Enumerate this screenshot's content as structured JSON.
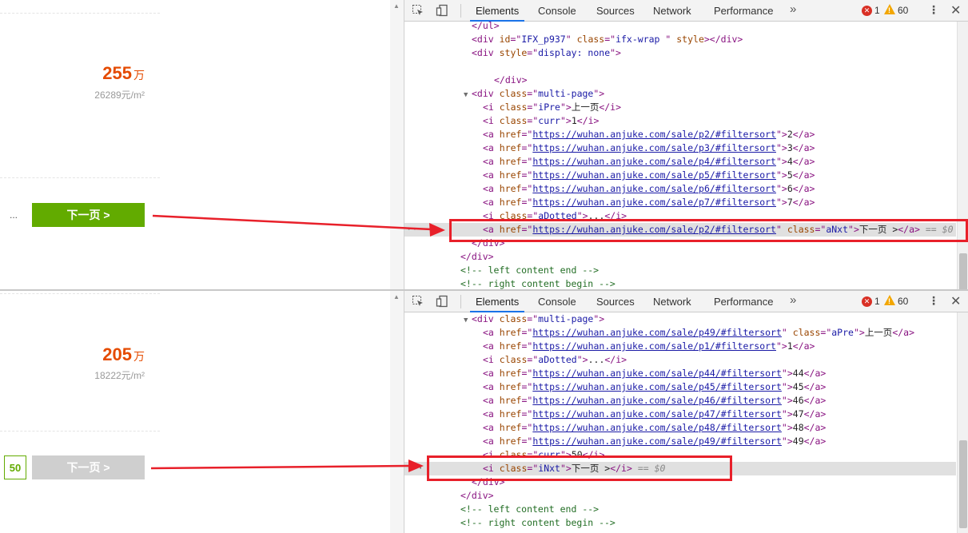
{
  "top": {
    "listing": {
      "price": "255",
      "price_unit": "万",
      "unit_price": "26289元/m²"
    },
    "ellipsis": "...",
    "next_button": "下一页 >",
    "devtools": {
      "tabs": [
        "Elements",
        "Console",
        "Sources",
        "Network",
        "Performance"
      ],
      "more": "»",
      "errors": "1",
      "warnings": "60",
      "lines": [
        {
          "indent": 12,
          "t": [
            [
              "tag",
              "</ul>"
            ]
          ]
        },
        {
          "indent": 12,
          "t": [
            [
              "tag",
              "<div "
            ],
            [
              "an",
              "id"
            ],
            [
              "tag",
              "=\""
            ],
            [
              "av",
              "IFX_p937"
            ],
            [
              "tag",
              "\" "
            ],
            [
              "an",
              "class"
            ],
            [
              "tag",
              "=\""
            ],
            [
              "av",
              "ifx-wrap "
            ],
            [
              "tag",
              "\" "
            ],
            [
              "an",
              "style"
            ],
            [
              "tag",
              "></div>"
            ]
          ]
        },
        {
          "indent": 12,
          "t": [
            [
              "tag",
              "<div "
            ],
            [
              "an",
              "style"
            ],
            [
              "tag",
              "=\""
            ],
            [
              "av",
              "display: none"
            ],
            [
              "tag",
              "\">"
            ]
          ]
        },
        {
          "indent": 12,
          "t": []
        },
        {
          "indent": 16,
          "t": [
            [
              "tag",
              "</div>"
            ]
          ]
        },
        {
          "indent": 12,
          "tw": "▼",
          "t": [
            [
              "tag",
              "<div "
            ],
            [
              "an",
              "class"
            ],
            [
              "tag",
              "=\""
            ],
            [
              "av",
              "multi-page"
            ],
            [
              "tag",
              "\">"
            ]
          ]
        },
        {
          "indent": 14,
          "t": [
            [
              "tag",
              "<i "
            ],
            [
              "an",
              "class"
            ],
            [
              "tag",
              "=\""
            ],
            [
              "av",
              "iPre"
            ],
            [
              "tag",
              "\">"
            ],
            [
              "tx",
              "上一页"
            ],
            [
              "tag",
              "</i>"
            ]
          ]
        },
        {
          "indent": 14,
          "t": [
            [
              "tag",
              "<i "
            ],
            [
              "an",
              "class"
            ],
            [
              "tag",
              "=\""
            ],
            [
              "av",
              "curr"
            ],
            [
              "tag",
              "\">"
            ],
            [
              "tx",
              "1"
            ],
            [
              "tag",
              "</i>"
            ]
          ]
        },
        {
          "indent": 14,
          "t": [
            [
              "tag",
              "<a "
            ],
            [
              "an",
              "href"
            ],
            [
              "tag",
              "=\""
            ],
            [
              "lk",
              "https://wuhan.anjuke.com/sale/p2/#filtersort"
            ],
            [
              "tag",
              "\">"
            ],
            [
              "tx",
              "2"
            ],
            [
              "tag",
              "</a>"
            ]
          ]
        },
        {
          "indent": 14,
          "t": [
            [
              "tag",
              "<a "
            ],
            [
              "an",
              "href"
            ],
            [
              "tag",
              "=\""
            ],
            [
              "lk",
              "https://wuhan.anjuke.com/sale/p3/#filtersort"
            ],
            [
              "tag",
              "\">"
            ],
            [
              "tx",
              "3"
            ],
            [
              "tag",
              "</a>"
            ]
          ]
        },
        {
          "indent": 14,
          "t": [
            [
              "tag",
              "<a "
            ],
            [
              "an",
              "href"
            ],
            [
              "tag",
              "=\""
            ],
            [
              "lk",
              "https://wuhan.anjuke.com/sale/p4/#filtersort"
            ],
            [
              "tag",
              "\">"
            ],
            [
              "tx",
              "4"
            ],
            [
              "tag",
              "</a>"
            ]
          ]
        },
        {
          "indent": 14,
          "t": [
            [
              "tag",
              "<a "
            ],
            [
              "an",
              "href"
            ],
            [
              "tag",
              "=\""
            ],
            [
              "lk",
              "https://wuhan.anjuke.com/sale/p5/#filtersort"
            ],
            [
              "tag",
              "\">"
            ],
            [
              "tx",
              "5"
            ],
            [
              "tag",
              "</a>"
            ]
          ]
        },
        {
          "indent": 14,
          "t": [
            [
              "tag",
              "<a "
            ],
            [
              "an",
              "href"
            ],
            [
              "tag",
              "=\""
            ],
            [
              "lk",
              "https://wuhan.anjuke.com/sale/p6/#filtersort"
            ],
            [
              "tag",
              "\">"
            ],
            [
              "tx",
              "6"
            ],
            [
              "tag",
              "</a>"
            ]
          ]
        },
        {
          "indent": 14,
          "t": [
            [
              "tag",
              "<a "
            ],
            [
              "an",
              "href"
            ],
            [
              "tag",
              "=\""
            ],
            [
              "lk",
              "https://wuhan.anjuke.com/sale/p7/#filtersort"
            ],
            [
              "tag",
              "\">"
            ],
            [
              "tx",
              "7"
            ],
            [
              "tag",
              "</a>"
            ]
          ]
        },
        {
          "indent": 14,
          "t": [
            [
              "tag",
              "<i "
            ],
            [
              "an",
              "class"
            ],
            [
              "tag",
              "=\""
            ],
            [
              "av",
              "aDotted"
            ],
            [
              "tag",
              "\">"
            ],
            [
              "tx",
              "..."
            ],
            [
              "tag",
              "</i>"
            ]
          ]
        },
        {
          "indent": 14,
          "sel": true,
          "t": [
            [
              "tag",
              "<a "
            ],
            [
              "an",
              "href"
            ],
            [
              "tag",
              "=\""
            ],
            [
              "lk",
              "https://wuhan.anjuke.com/sale/p2/#filtersort"
            ],
            [
              "tag",
              "\" "
            ],
            [
              "an",
              "class"
            ],
            [
              "tag",
              "=\""
            ],
            [
              "av",
              "aNxt"
            ],
            [
              "tag",
              "\">"
            ],
            [
              "tx",
              "下一页 >"
            ],
            [
              "tag",
              "</a>"
            ],
            [
              "sv",
              " == $0"
            ]
          ]
        },
        {
          "indent": 12,
          "t": [
            [
              "tag",
              "</div>"
            ]
          ]
        },
        {
          "indent": 10,
          "t": [
            [
              "tag",
              "</div>"
            ]
          ]
        },
        {
          "indent": 10,
          "t": [
            [
              "cm",
              "<!-- left content end -->"
            ]
          ]
        },
        {
          "indent": 10,
          "t": [
            [
              "cm",
              "<!-- right content begin -->"
            ]
          ]
        }
      ]
    }
  },
  "bottom": {
    "listing": {
      "price": "205",
      "price_unit": "万",
      "unit_price": "18222元/m²"
    },
    "current_page": "50",
    "next_button": "下一页 >",
    "devtools": {
      "tabs": [
        "Elements",
        "Console",
        "Sources",
        "Network",
        "Performance"
      ],
      "more": "»",
      "errors": "1",
      "warnings": "60",
      "lines": [
        {
          "indent": 12,
          "tw": "▼",
          "t": [
            [
              "tag",
              "<div "
            ],
            [
              "an",
              "class"
            ],
            [
              "tag",
              "=\""
            ],
            [
              "av",
              "multi-page"
            ],
            [
              "tag",
              "\">"
            ]
          ]
        },
        {
          "indent": 14,
          "t": [
            [
              "tag",
              "<a "
            ],
            [
              "an",
              "href"
            ],
            [
              "tag",
              "=\""
            ],
            [
              "lk",
              "https://wuhan.anjuke.com/sale/p49/#filtersort"
            ],
            [
              "tag",
              "\" "
            ],
            [
              "an",
              "class"
            ],
            [
              "tag",
              "=\""
            ],
            [
              "av",
              "aPre"
            ],
            [
              "tag",
              "\">"
            ],
            [
              "tx",
              "上一页"
            ],
            [
              "tag",
              "</a>"
            ]
          ]
        },
        {
          "indent": 14,
          "t": [
            [
              "tag",
              "<a "
            ],
            [
              "an",
              "href"
            ],
            [
              "tag",
              "=\""
            ],
            [
              "lk",
              "https://wuhan.anjuke.com/sale/p1/#filtersort"
            ],
            [
              "tag",
              "\">"
            ],
            [
              "tx",
              "1"
            ],
            [
              "tag",
              "</a>"
            ]
          ]
        },
        {
          "indent": 14,
          "t": [
            [
              "tag",
              "<i "
            ],
            [
              "an",
              "class"
            ],
            [
              "tag",
              "=\""
            ],
            [
              "av",
              "aDotted"
            ],
            [
              "tag",
              "\">"
            ],
            [
              "tx",
              "..."
            ],
            [
              "tag",
              "</i>"
            ]
          ]
        },
        {
          "indent": 14,
          "t": [
            [
              "tag",
              "<a "
            ],
            [
              "an",
              "href"
            ],
            [
              "tag",
              "=\""
            ],
            [
              "lk",
              "https://wuhan.anjuke.com/sale/p44/#filtersort"
            ],
            [
              "tag",
              "\">"
            ],
            [
              "tx",
              "44"
            ],
            [
              "tag",
              "</a>"
            ]
          ]
        },
        {
          "indent": 14,
          "t": [
            [
              "tag",
              "<a "
            ],
            [
              "an",
              "href"
            ],
            [
              "tag",
              "=\""
            ],
            [
              "lk",
              "https://wuhan.anjuke.com/sale/p45/#filtersort"
            ],
            [
              "tag",
              "\">"
            ],
            [
              "tx",
              "45"
            ],
            [
              "tag",
              "</a>"
            ]
          ]
        },
        {
          "indent": 14,
          "t": [
            [
              "tag",
              "<a "
            ],
            [
              "an",
              "href"
            ],
            [
              "tag",
              "=\""
            ],
            [
              "lk",
              "https://wuhan.anjuke.com/sale/p46/#filtersort"
            ],
            [
              "tag",
              "\">"
            ],
            [
              "tx",
              "46"
            ],
            [
              "tag",
              "</a>"
            ]
          ]
        },
        {
          "indent": 14,
          "t": [
            [
              "tag",
              "<a "
            ],
            [
              "an",
              "href"
            ],
            [
              "tag",
              "=\""
            ],
            [
              "lk",
              "https://wuhan.anjuke.com/sale/p47/#filtersort"
            ],
            [
              "tag",
              "\">"
            ],
            [
              "tx",
              "47"
            ],
            [
              "tag",
              "</a>"
            ]
          ]
        },
        {
          "indent": 14,
          "t": [
            [
              "tag",
              "<a "
            ],
            [
              "an",
              "href"
            ],
            [
              "tag",
              "=\""
            ],
            [
              "lk",
              "https://wuhan.anjuke.com/sale/p48/#filtersort"
            ],
            [
              "tag",
              "\">"
            ],
            [
              "tx",
              "48"
            ],
            [
              "tag",
              "</a>"
            ]
          ]
        },
        {
          "indent": 14,
          "t": [
            [
              "tag",
              "<a "
            ],
            [
              "an",
              "href"
            ],
            [
              "tag",
              "=\""
            ],
            [
              "lk",
              "https://wuhan.anjuke.com/sale/p49/#filtersort"
            ],
            [
              "tag",
              "\">"
            ],
            [
              "tx",
              "49"
            ],
            [
              "tag",
              "</a>"
            ]
          ]
        },
        {
          "indent": 14,
          "t": [
            [
              "tag",
              "<i "
            ],
            [
              "an",
              "class"
            ],
            [
              "tag",
              "=\""
            ],
            [
              "av",
              "curr"
            ],
            [
              "tag",
              "\">"
            ],
            [
              "tx",
              "50"
            ],
            [
              "tag",
              "</i>"
            ]
          ]
        },
        {
          "indent": 14,
          "sel": true,
          "t": [
            [
              "tag",
              "<i "
            ],
            [
              "an",
              "class"
            ],
            [
              "tag",
              "=\""
            ],
            [
              "av",
              "iNxt"
            ],
            [
              "tag",
              "\">"
            ],
            [
              "tx",
              "下一页 >"
            ],
            [
              "tag",
              "</i>"
            ],
            [
              "sv",
              " == $0"
            ]
          ]
        },
        {
          "indent": 12,
          "t": [
            [
              "tag",
              "</div>"
            ]
          ]
        },
        {
          "indent": 10,
          "t": [
            [
              "tag",
              "</div>"
            ]
          ]
        },
        {
          "indent": 10,
          "t": [
            [
              "cm",
              "<!-- left content end -->"
            ]
          ]
        },
        {
          "indent": 10,
          "t": [
            [
              "cm",
              "<!-- right content begin -->"
            ]
          ]
        }
      ]
    }
  },
  "colors": {
    "accent_green": "#62ab00",
    "price_orange": "#e54b00",
    "annotation_red": "#e8202a",
    "devtools_blue": "#1a73e8"
  },
  "icons": [
    "inspect-icon",
    "device-toolbar-icon",
    "error-icon",
    "warning-icon",
    "kebab-menu-icon",
    "close-icon",
    "more-tabs-icon",
    "expand-triangle-icon"
  ]
}
